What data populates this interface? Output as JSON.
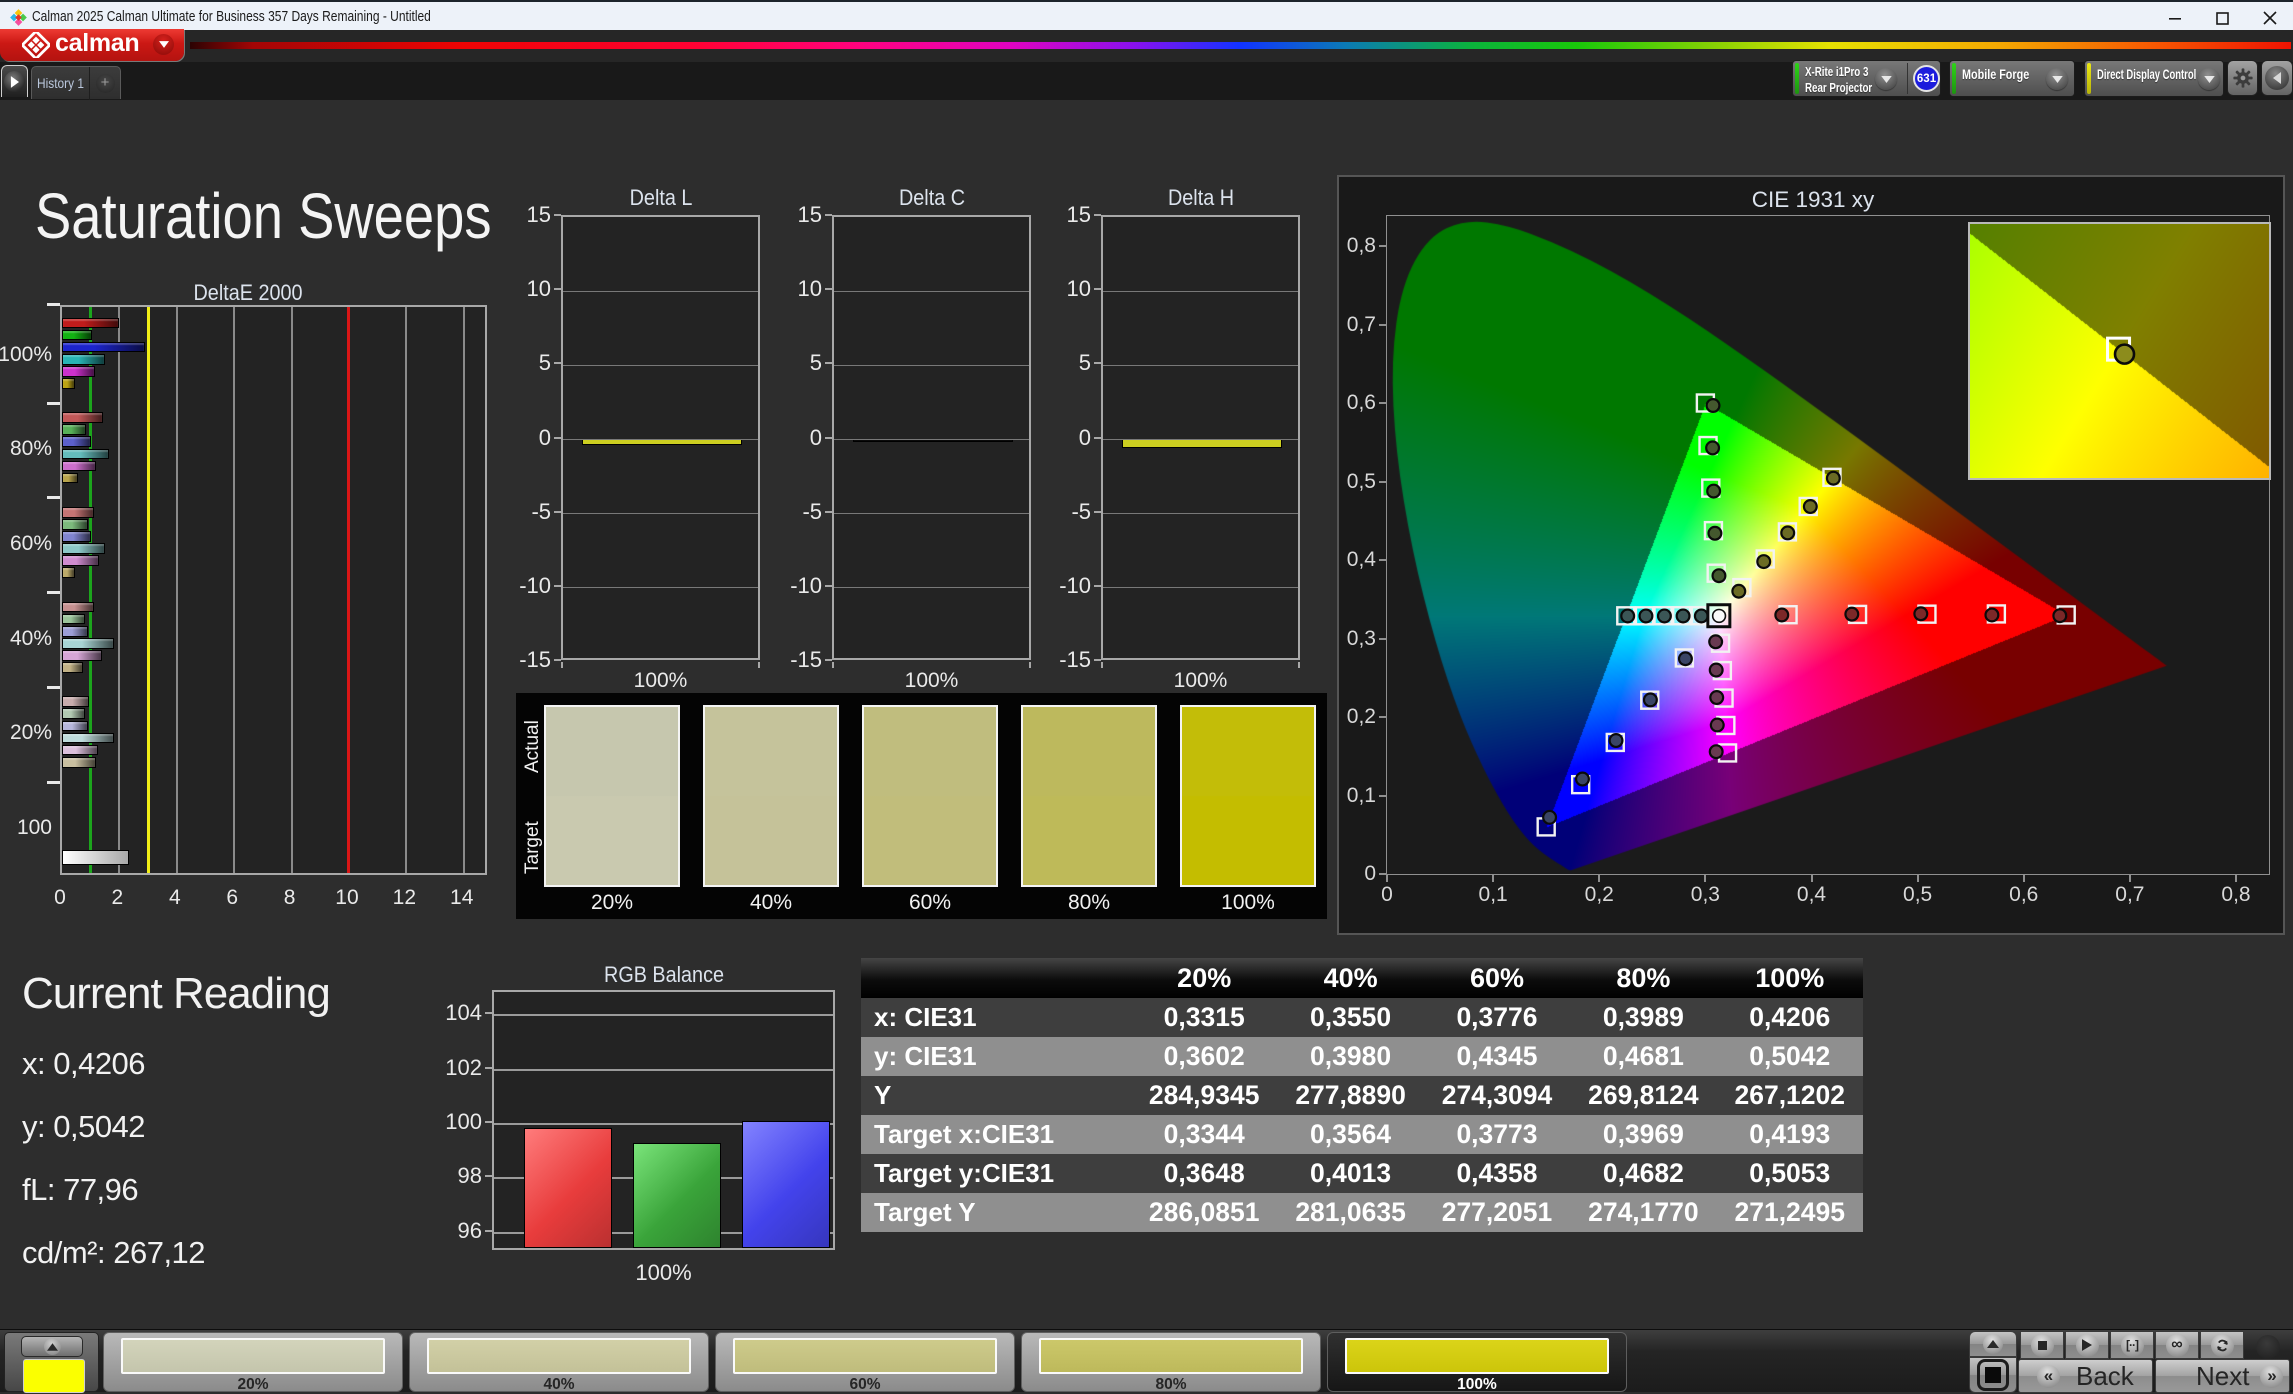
{
  "window": {
    "title": "Calman 2025 Calman Ultimate for Business 357 Days Remaining  - Untitled",
    "controls": [
      "minimize",
      "maximize",
      "close"
    ]
  },
  "brand": {
    "wordmark": "calman",
    "accent": "#cb1814"
  },
  "tabs": {
    "active": "History 1",
    "add_label": "+"
  },
  "toolbar": {
    "meter": {
      "line1": "X-Rite i1Pro 3",
      "line2": "Rear Projector",
      "badge": "631",
      "accent": "#2ed318",
      "badge_color": "#1c1cdc"
    },
    "source": {
      "label": "Mobile Forge",
      "accent": "#2ed318"
    },
    "display_control": {
      "label": "Direct Display Control",
      "accent": "#ece813"
    },
    "buttons": [
      "settings-gear",
      "collapse-arrow"
    ]
  },
  "page": {
    "title": "Saturation Sweeps"
  },
  "chart_data": {
    "deltae": {
      "type": "bar",
      "title": "DeltaE 2000",
      "xticks": [
        0,
        2,
        4,
        6,
        8,
        10,
        12,
        14
      ],
      "xmax": 14.88,
      "ref_lines": [
        {
          "value": 1,
          "color": "#1ca51c"
        },
        {
          "value": 3,
          "color": "#f2ee16"
        },
        {
          "value": 10,
          "color": "#da1616"
        }
      ],
      "series_names": [
        "red",
        "green",
        "blue",
        "cyan",
        "magenta",
        "yellow"
      ],
      "groups": [
        {
          "label": "100%",
          "values": [
            2.0,
            1.05,
            2.88,
            1.5,
            1.15,
            0.45
          ],
          "colors": [
            "#c01c1c",
            "#12b412",
            "#1c24cc",
            "#28b4b4",
            "#cc30cc",
            "#bca414"
          ]
        },
        {
          "label": "80%",
          "values": [
            1.42,
            0.85,
            1.0,
            1.65,
            1.2,
            0.55
          ],
          "colors": [
            "#c25858",
            "#58b058",
            "#5c60cc",
            "#64bcbc",
            "#cc6ecc",
            "#b8a44c"
          ]
        },
        {
          "label": "60%",
          "values": [
            1.1,
            0.9,
            1.0,
            1.5,
            1.3,
            0.45
          ],
          "colors": [
            "#c47474",
            "#7cba7c",
            "#8084d0",
            "#8cc8c8",
            "#d08cd0",
            "#bcaa6a"
          ]
        },
        {
          "label": "40%",
          "values": [
            1.1,
            0.8,
            0.92,
            1.8,
            1.4,
            0.72
          ],
          "colors": [
            "#c69090",
            "#9ac49a",
            "#9c9ed6",
            "#a8d4d4",
            "#d6a6d6",
            "#c2b286"
          ]
        },
        {
          "label": "20%",
          "values": [
            0.95,
            0.8,
            0.92,
            1.82,
            1.25,
            1.18
          ],
          "colors": [
            "#c9adad",
            "#b2c9b2",
            "#b6b6dc",
            "#bedcdc",
            "#dcc0dc",
            "#c9bfa0"
          ]
        },
        {
          "label": "100",
          "values": [
            2.35
          ],
          "colors": [
            "#ffffff"
          ]
        }
      ]
    },
    "delta_minis": [
      {
        "title": "Delta L",
        "category": "100%",
        "value": -0.4,
        "color": "#ccce20"
      },
      {
        "title": "Delta C",
        "category": "100%",
        "value": -0.15,
        "color": "#0a0a0a"
      },
      {
        "title": "Delta H",
        "category": "100%",
        "value": -0.55,
        "color": "#ccce20"
      }
    ],
    "mini_yticks": [
      15,
      10,
      5,
      0,
      -5,
      -10,
      -15
    ],
    "comparator": {
      "row_labels": [
        "Actual",
        "Target"
      ],
      "swatches": [
        {
          "label": "20%",
          "actual": "#c6c7ae",
          "target": "#c9c9af"
        },
        {
          "label": "40%",
          "actual": "#c5c39b",
          "target": "#c5c299"
        },
        {
          "label": "60%",
          "actual": "#c0bd7e",
          "target": "#c1bd7b"
        },
        {
          "label": "80%",
          "actual": "#bdb95d",
          "target": "#beba59"
        },
        {
          "label": "100%",
          "actual": "#c3bd08",
          "target": "#c4bd00"
        }
      ]
    },
    "cie": {
      "type": "scatter",
      "title": "CIE 1931 xy",
      "xlim": [
        0,
        0.832
      ],
      "ylim": [
        0,
        0.84
      ],
      "xticks": [
        "0",
        "0,1",
        "0,2",
        "0,3",
        "0,4",
        "0,5",
        "0,6",
        "0,7",
        "0,8"
      ],
      "yticks": [
        "0",
        "0,1",
        "0,2",
        "0,3",
        "0,4",
        "0,5",
        "0,6",
        "0,7",
        "0,8"
      ],
      "tick_step": 0.1,
      "white_point": {
        "target": [
          0.3127,
          0.329
        ],
        "measured": [
          0.3129,
          0.3288
        ]
      },
      "sweeps": [
        {
          "name": "red",
          "dot_color": "#7c2828",
          "targets": [
            [
              0.3779,
              0.3303
            ],
            [
              0.4434,
              0.3307
            ],
            [
              0.5088,
              0.331
            ],
            [
              0.5742,
              0.3313
            ],
            [
              0.64,
              0.33
            ]
          ],
          "measured": [
            [
              0.372,
              0.33
            ],
            [
              0.438,
              0.331
            ],
            [
              0.503,
              0.3315
            ],
            [
              0.57,
              0.33
            ],
            [
              0.634,
              0.329
            ]
          ]
        },
        {
          "name": "green",
          "dot_color": "#44582e",
          "targets": [
            [
              0.3102,
              0.3832
            ],
            [
              0.3076,
              0.4374
            ],
            [
              0.3051,
              0.4916
            ],
            [
              0.3025,
              0.5458
            ],
            [
              0.3,
              0.6
            ]
          ],
          "measured": [
            [
              0.3128,
              0.38
            ],
            [
              0.309,
              0.434
            ],
            [
              0.3078,
              0.4878
            ],
            [
              0.3068,
              0.5428
            ],
            [
              0.3072,
              0.5968
            ]
          ]
        },
        {
          "name": "blue",
          "dot_color": "#3a4565",
          "targets": [
            [
              0.2802,
              0.2752
            ],
            [
              0.2476,
              0.2214
            ],
            [
              0.2151,
              0.1676
            ],
            [
              0.1825,
              0.1138
            ],
            [
              0.15,
              0.06
            ]
          ],
          "measured": [
            [
              0.2812,
              0.2742
            ],
            [
              0.2482,
              0.2218
            ],
            [
              0.2158,
              0.17
            ],
            [
              0.1842,
              0.121
            ],
            [
              0.1532,
              0.0722
            ]
          ]
        },
        {
          "name": "cyan",
          "dot_color": "#3b5656",
          "targets": [
            [
              0.2952,
              0.329
            ],
            [
              0.2777,
              0.329
            ],
            [
              0.2601,
              0.329
            ],
            [
              0.2426,
              0.3289
            ],
            [
              0.225,
              0.3289
            ]
          ],
          "measured": [
            [
              0.2962,
              0.3287
            ],
            [
              0.279,
              0.3287
            ],
            [
              0.2614,
              0.3287
            ],
            [
              0.244,
              0.3287
            ],
            [
              0.2268,
              0.3287
            ]
          ]
        },
        {
          "name": "magenta",
          "dot_color": "#693a52",
          "targets": [
            [
              0.3143,
              0.294
            ],
            [
              0.316,
              0.2591
            ],
            [
              0.3176,
              0.2241
            ],
            [
              0.3193,
              0.1892
            ],
            [
              0.3209,
              0.1542
            ]
          ],
          "measured": [
            [
              0.3097,
              0.2958
            ],
            [
              0.3102,
              0.2598
            ],
            [
              0.3107,
              0.2248
            ],
            [
              0.3112,
              0.1898
            ],
            [
              0.3102,
              0.1558
            ]
          ]
        },
        {
          "name": "yellow",
          "dot_color": "#6b6b24",
          "targets": [
            [
              0.3344,
              0.3648
            ],
            [
              0.3564,
              0.4013
            ],
            [
              0.3773,
              0.4358
            ],
            [
              0.3969,
              0.4682
            ],
            [
              0.4193,
              0.5053
            ]
          ],
          "measured": [
            [
              0.3315,
              0.3602
            ],
            [
              0.355,
              0.398
            ],
            [
              0.3776,
              0.4345
            ],
            [
              0.3989,
              0.4681
            ],
            [
              0.4206,
              0.5042
            ]
          ]
        }
      ],
      "gamut_triangle": {
        "red": [
          0.64,
          0.33
        ],
        "green": [
          0.3,
          0.6
        ],
        "blue": [
          0.15,
          0.06
        ]
      },
      "inset": {
        "x_range": [
          0.387,
          0.4518
        ],
        "y_range": [
          0.477,
          0.533
        ],
        "target": [
          0.4193,
          0.5053
        ],
        "measured": [
          0.4206,
          0.5042
        ],
        "dot_color": "#8c8c1c"
      }
    },
    "rgb_balance": {
      "type": "bar",
      "title": "RGB Balance",
      "category": "100%",
      "yticks": [
        96,
        98,
        100,
        102,
        104
      ],
      "ylim": [
        95.3,
        104.85
      ],
      "series": [
        {
          "name": "red",
          "value": 99.85,
          "color": "#e83c3c"
        },
        {
          "name": "green",
          "value": 99.3,
          "color": "#3aa43a"
        },
        {
          "name": "blue",
          "value": 100.1,
          "color": "#4343ec"
        }
      ]
    }
  },
  "reading": {
    "title": "Current Reading",
    "lines": [
      "x: 0,4206",
      "y: 0,5042",
      "fL: 77,96",
      "cd/m²: 267,12"
    ]
  },
  "table": {
    "columns": [
      "20%",
      "40%",
      "60%",
      "80%",
      "100%"
    ],
    "rows": [
      {
        "label": "x: CIE31",
        "values": [
          "0,3315",
          "0,3550",
          "0,3776",
          "0,3989",
          "0,4206"
        ]
      },
      {
        "label": "y: CIE31",
        "values": [
          "0,3602",
          "0,3980",
          "0,4345",
          "0,4681",
          "0,5042"
        ]
      },
      {
        "label": "Y",
        "values": [
          "284,9345",
          "277,8890",
          "274,3094",
          "269,8124",
          "267,1202"
        ]
      },
      {
        "label": "Target x:CIE31",
        "values": [
          "0,3344",
          "0,3564",
          "0,3773",
          "0,3969",
          "0,4193"
        ]
      },
      {
        "label": "Target y:CIE31",
        "values": [
          "0,3648",
          "0,4013",
          "0,4358",
          "0,4682",
          "0,5053"
        ]
      },
      {
        "label": "Target Y",
        "values": [
          "286,0851",
          "281,0635",
          "277,2051",
          "274,1770",
          "271,2495"
        ]
      }
    ],
    "dark_row_bg": "#3e3e3e",
    "light_row_bg": "#8f8f8f"
  },
  "footer": {
    "current_color": "#fbff00",
    "thumbnails": [
      {
        "label": "20%",
        "color": "#c4c5ac",
        "selected": false
      },
      {
        "label": "40%",
        "color": "#c3c198",
        "selected": false
      },
      {
        "label": "60%",
        "color": "#bfbc7c",
        "selected": false
      },
      {
        "label": "80%",
        "color": "#bdb95b",
        "selected": false
      },
      {
        "label": "100%",
        "color": "#ccc50a",
        "selected": true
      }
    ],
    "transport": [
      "stop",
      "play",
      "loop",
      "infinity",
      "refresh"
    ],
    "back_label": "Back",
    "next_label": "Next"
  }
}
